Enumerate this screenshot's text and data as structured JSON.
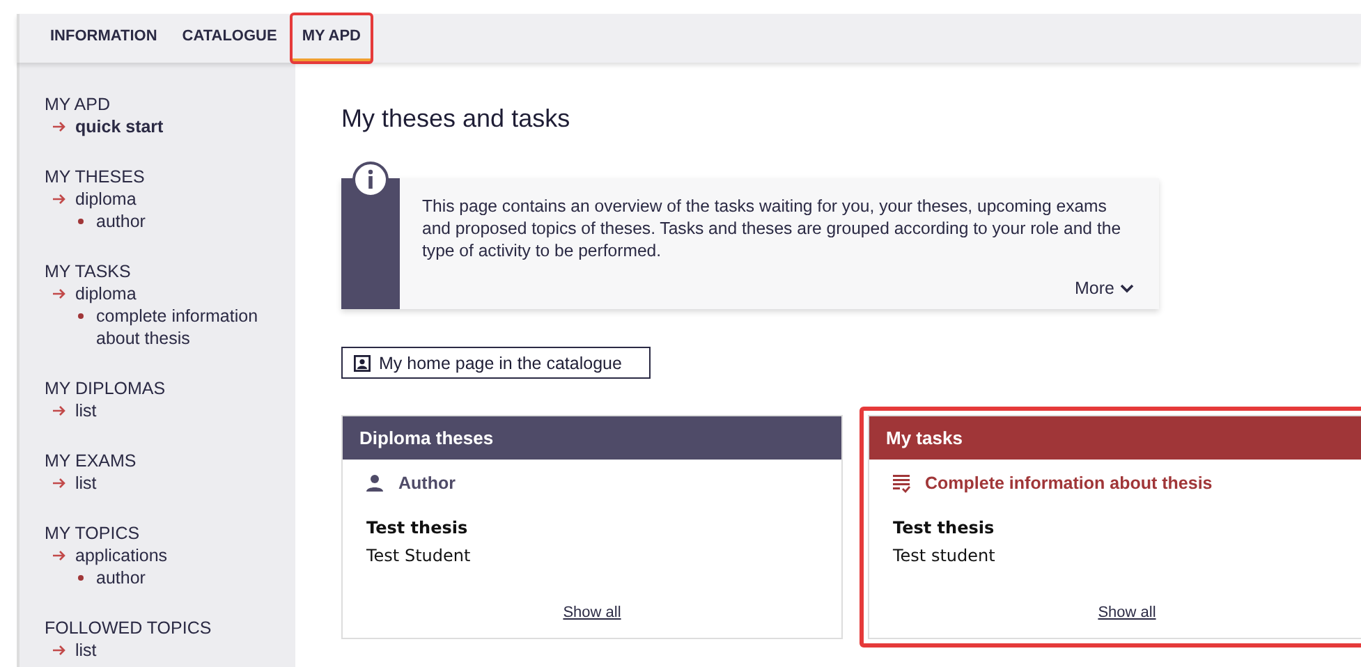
{
  "tabs": [
    {
      "label": "INFORMATION",
      "selected": false,
      "highlighted": false
    },
    {
      "label": "CATALOGUE",
      "selected": false,
      "highlighted": false
    },
    {
      "label": "MY APD",
      "selected": true,
      "highlighted": true
    }
  ],
  "sidebar": {
    "sections": [
      {
        "title": "MY APD",
        "children": [
          {
            "label": "quick start",
            "selected": true
          }
        ]
      },
      {
        "title": "MY THESES",
        "children": [
          {
            "label": "diploma",
            "selected": false,
            "children": [
              {
                "label": "author"
              }
            ]
          }
        ]
      },
      {
        "title": "MY TASKS",
        "children": [
          {
            "label": "diploma",
            "selected": false,
            "children": [
              {
                "label": "complete information about thesis"
              }
            ]
          }
        ]
      },
      {
        "title": "MY DIPLOMAS",
        "children": [
          {
            "label": "list",
            "selected": false
          }
        ]
      },
      {
        "title": "MY EXAMS",
        "children": [
          {
            "label": "list",
            "selected": false
          }
        ]
      },
      {
        "title": "MY TOPICS",
        "children": [
          {
            "label": "applications",
            "selected": false,
            "children": [
              {
                "label": "author"
              }
            ]
          }
        ]
      },
      {
        "title": "FOLLOWED TOPICS",
        "children": [
          {
            "label": "list",
            "selected": false
          }
        ]
      }
    ]
  },
  "page_title": "My theses and tasks",
  "info": {
    "text": "This page contains an overview of the tasks waiting for you, your theses, upcoming exams and proposed topics of theses. Tasks and theses are grouped according to your role and the type of activity to be performed.",
    "more": "More"
  },
  "home_button": "My home page in the catalogue",
  "cards": [
    {
      "title": "Diploma theses",
      "kind": "theses",
      "highlighted": false,
      "subtitle": "Author",
      "item_title": "Test thesis",
      "item_person": "Test Student",
      "link": "Show all"
    },
    {
      "title": "My tasks",
      "kind": "tasks",
      "highlighted": true,
      "subtitle": "Complete information about thesis",
      "item_title": "Test thesis",
      "item_person": "Test student",
      "link": "Show all"
    }
  ]
}
